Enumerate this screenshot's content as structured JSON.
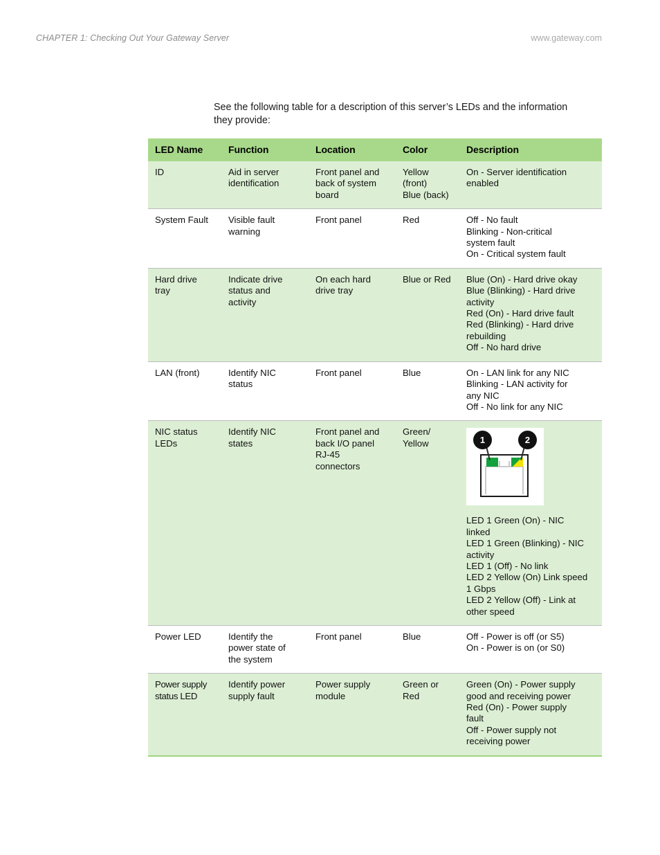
{
  "header": {
    "chapter": "CHAPTER 1: Checking Out Your Gateway Server",
    "site": "www.gateway.com"
  },
  "intro": "See the following table for a description of this server’s LEDs and the information they provide:",
  "colors": {
    "header_green": "#a8d98a",
    "row_tint_green": "#dcefd4",
    "rule_gray": "#bcbcbc",
    "bottom_border_green": "#9ed47e",
    "led_green": "#13a23d",
    "led_yellow": "#f2e400",
    "callout_black": "#111111"
  },
  "table": {
    "columns": [
      "LED Name",
      "Function",
      "Location",
      "Color",
      "Description"
    ],
    "rows": [
      {
        "shaded": true,
        "led_name": [
          "ID"
        ],
        "function": [
          "Aid in server",
          "identification"
        ],
        "location": [
          "Front panel and",
          "back of system",
          "board"
        ],
        "color": [
          "Yellow",
          "(front)",
          "Blue (back)"
        ],
        "description": [
          "On - Server identification",
          "enabled"
        ]
      },
      {
        "shaded": false,
        "led_name": [
          "System Fault"
        ],
        "function": [
          "Visible fault",
          "warning"
        ],
        "location": [
          "Front panel"
        ],
        "color": [
          "Red"
        ],
        "description": [
          "Off - No fault",
          "Blinking - Non-critical",
          "system fault",
          "On - Critical system fault"
        ]
      },
      {
        "shaded": true,
        "led_name": [
          "Hard drive",
          "tray"
        ],
        "function": [
          "Indicate drive",
          "status and",
          "activity"
        ],
        "location": [
          "On each hard",
          "drive tray"
        ],
        "color": [
          "Blue or Red"
        ],
        "description": [
          "Blue (On) - Hard drive okay",
          "Blue (Blinking) - Hard drive",
          "activity",
          "Red (On) - Hard drive fault",
          "Red (Blinking) - Hard drive",
          "rebuilding",
          "Off - No hard drive"
        ]
      },
      {
        "shaded": false,
        "led_name": [
          "LAN (front)"
        ],
        "function": [
          "Identify NIC",
          "status"
        ],
        "location": [
          "Front panel"
        ],
        "color": [
          "Blue"
        ],
        "description": [
          "On - LAN link for any NIC",
          "Blinking - LAN activity for",
          "any NIC",
          "Off - No link for any NIC"
        ]
      },
      {
        "shaded": true,
        "has_figure": true,
        "led_name": [
          "NIC status",
          "LEDs"
        ],
        "function": [
          "Identify NIC",
          "states"
        ],
        "location": [
          "Front panel and",
          "back I/O panel",
          "RJ-45",
          "connectors"
        ],
        "color": [
          "Green/",
          "Yellow"
        ],
        "description": [
          "LED 1 Green (On) - NIC",
          "linked",
          "LED 1 Green (Blinking) - NIC",
          "activity",
          "LED 1 (Off) - No link",
          "LED 2 Yellow (On) Link speed",
          "1 Gbps",
          "LED 2 Yellow (Off) - Link at",
          "other speed"
        ],
        "figure": {
          "name": "rj45-connector-diagram",
          "callout_1": "1",
          "callout_2": "2",
          "led_1_color": "green",
          "led_2_color": "green/yellow"
        }
      },
      {
        "shaded": false,
        "led_name": [
          "Power LED"
        ],
        "function": [
          "Identify the",
          "power state of",
          "the system"
        ],
        "location": [
          "Front panel"
        ],
        "color": [
          "Blue"
        ],
        "description": [
          "Off - Power is off (or S5)",
          "On - Power is on (or S0)"
        ]
      },
      {
        "shaded": true,
        "led_name": [
          "Power supply",
          "status LED"
        ],
        "function": [
          "Identify power",
          "supply fault"
        ],
        "location": [
          "Power supply",
          "module"
        ],
        "color": [
          "Green or",
          "Red"
        ],
        "description": [
          "Green (On) - Power supply",
          "good and receiving power",
          "Red (On) - Power supply",
          "fault",
          "Off - Power supply not",
          "receiving power"
        ]
      }
    ]
  }
}
